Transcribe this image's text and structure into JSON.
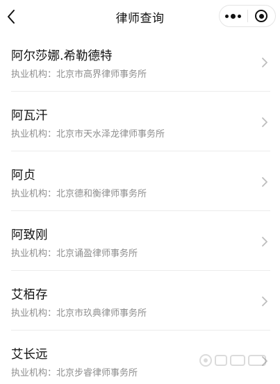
{
  "navbar": {
    "title": "律师查询"
  },
  "list": {
    "firm_prefix": "执业机构：",
    "items": [
      {
        "name": "阿尔莎娜.希勒德特",
        "firm": "北京市高界律师事务所"
      },
      {
        "name": "阿瓦汗",
        "firm": "北京市天水泽龙律师事务所"
      },
      {
        "name": "阿贞",
        "firm": "北京德和衡律师事务所"
      },
      {
        "name": "阿致刚",
        "firm": "北京诵盈律师事务所"
      },
      {
        "name": "艾栢存",
        "firm": "北京市玖典律师事务所"
      },
      {
        "name": "艾长远",
        "firm": "北京步睿律师事务所"
      }
    ]
  },
  "colors": {
    "text_primary": "#111111",
    "text_secondary": "#8e8e8e",
    "divider": "#ececec",
    "chevron": "#bdbdbd"
  },
  "icons": {
    "back": "chevron-left-icon",
    "more": "more-dots-icon",
    "close": "target-circle-icon",
    "row": "chevron-right-icon"
  }
}
